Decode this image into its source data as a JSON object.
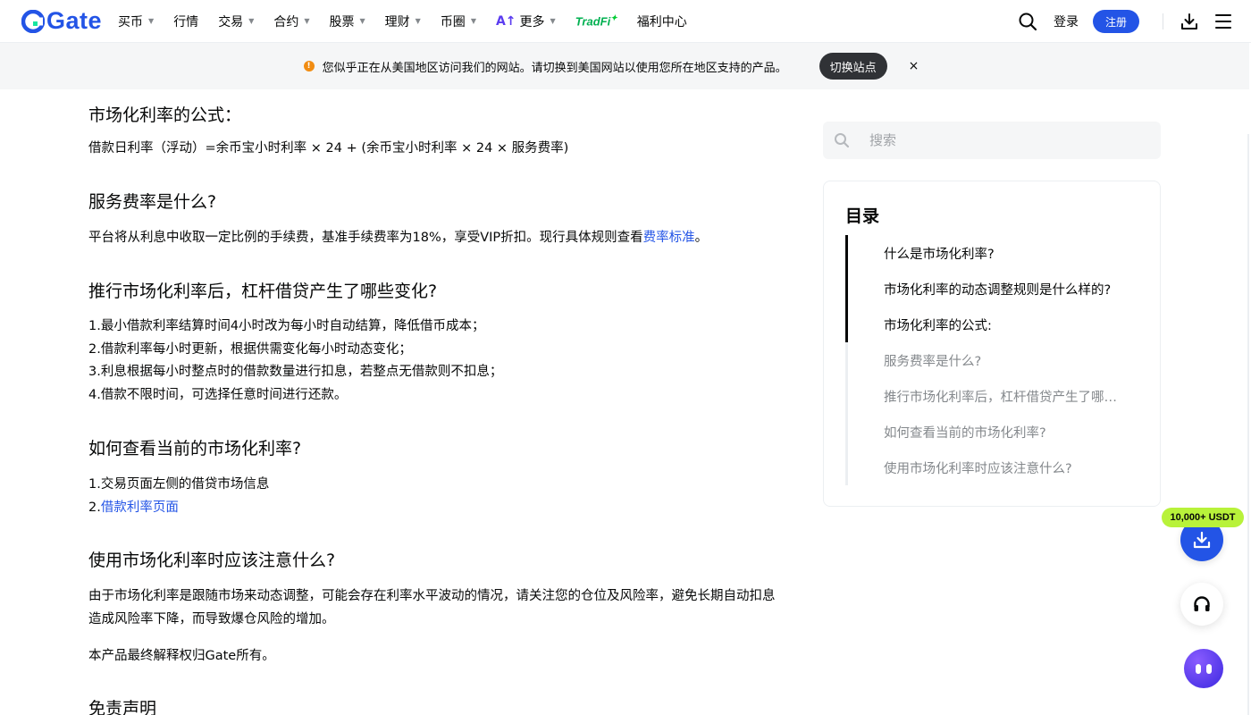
{
  "nav": {
    "logo": "Gate",
    "items": [
      {
        "label": "买币",
        "dropdown": true
      },
      {
        "label": "行情",
        "dropdown": false
      },
      {
        "label": "交易",
        "dropdown": true
      },
      {
        "label": "合约",
        "dropdown": true
      },
      {
        "label": "股票",
        "dropdown": true
      },
      {
        "label": "理财",
        "dropdown": true
      },
      {
        "label": "币圈",
        "dropdown": true
      }
    ],
    "more_label": "更多",
    "tradfi_label": "TradFi",
    "welfare_label": "福利中心",
    "login_label": "登录",
    "register_label": "注册",
    "brand_color": "#2354e6"
  },
  "banner": {
    "text": "您似乎正在从美国地区访问我们的网站。请切换到美国网站以使用您所在地区支持的产品。",
    "switch_label": "切换站点",
    "close_label": "×"
  },
  "article": {
    "partial_heading": "市场化利率的公式：",
    "formula": "借款日利率（浮动）=余币宝小时利率 × 24 + (余币宝小时利率 × 24 × 服务费率)",
    "fee_heading": "服务费率是什么?",
    "fee_text": "平台将从利息中收取一定比例的手续费，基准手续费率为18%，享受VIP折扣。现行具体规则查看",
    "fee_link": "费率标准",
    "fee_tail": "。",
    "changes_heading": "推行市场化利率后，杠杆借贷产生了哪些变化?",
    "changes": [
      "1.最小借款利率结算时间4小时改为每小时自动结算，降低借币成本；",
      "2.借款利率每小时更新，根据供需变化每小时动态变化；",
      "3.利息根据每小时整点时的借款数量进行扣息，若整点无借款则不扣息；",
      "4.借款不限时间，可选择任意时间进行还款。"
    ],
    "check_heading": "如何查看当前的市场化利率?",
    "check_1": "1.交易页面左侧的借贷市场信息",
    "check_2_prefix": "2.",
    "check_2_link": "借款利率页面",
    "notice_heading": "使用市场化利率时应该注意什么?",
    "notice_text": "由于市场化利率是跟随市场来动态调整，可能会存在利率水平波动的情况，请关注您的仓位及风险率，避免长期自动扣息造成风险率下降，而导致爆仓风险的增加。",
    "final_text": "本产品最终解释权归Gate所有。",
    "disclaimer_heading": "免责声明"
  },
  "sidebar": {
    "search_placeholder": "搜索",
    "toc_title": "目录",
    "toc_items": [
      {
        "label": "什么是市场化利率?",
        "read": true
      },
      {
        "label": "市场化利率的动态调整规则是什么样的?",
        "read": true
      },
      {
        "label": "市场化利率的公式:",
        "read": true
      },
      {
        "label": "服务费率是什么?",
        "read": false
      },
      {
        "label": "推行市场化利率后，杠杆借贷产生了哪些变化?",
        "read": false
      },
      {
        "label": "如何查看当前的市场化利率?",
        "read": false
      },
      {
        "label": "使用市场化利率时应该注意什么?",
        "read": false
      }
    ]
  },
  "floating": {
    "promo_badge": "10,000+ USDT"
  }
}
